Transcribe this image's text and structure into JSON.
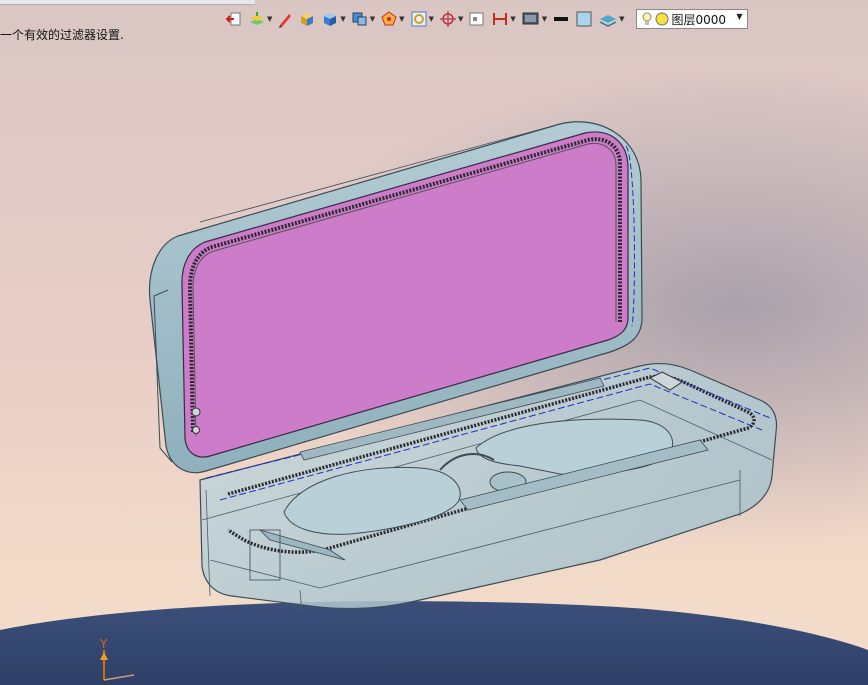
{
  "status": {
    "filter_message": "一个有效的过滤器设置."
  },
  "layer_selector": {
    "value": "图层0000"
  },
  "colors": {
    "lid_interior": "#cc7cc8",
    "case_shell": "#a8c2cc",
    "ground": "#3b4f7a"
  },
  "toolbar_icons": [
    "exit-icon",
    "layers-icon",
    "pencil-icon",
    "box-yellow-icon",
    "box-blue-icon",
    "view-cube-icon",
    "polygon-icon",
    "frame-icon",
    "snap-target-icon",
    "display-icon",
    "section-icon",
    "render-mode-icon",
    "line-weight-icon",
    "color-swatch-icon",
    "layer-stack-icon"
  ],
  "axis": {
    "y_label": "Y"
  }
}
